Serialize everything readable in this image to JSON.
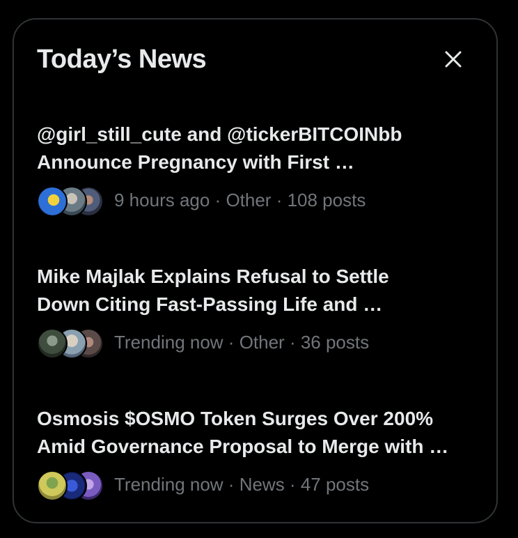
{
  "panel": {
    "title": "Today’s News",
    "close_label": "Close"
  },
  "news": [
    {
      "headline": "@girl_still_cute and @tickerBITCOINbb\nAnnounce Pregnancy with First …",
      "time": "9 hours ago",
      "category": "Other",
      "posts": "108 posts"
    },
    {
      "headline": "Mike Majlak Explains Refusal to Settle\nDown Citing Fast-Passing Life and …",
      "time": "Trending now",
      "category": "Other",
      "posts": "36 posts"
    },
    {
      "headline": "Osmosis $OSMO Token Surges Over 200%\nAmid Governance Proposal to Merge with …",
      "time": "Trending now",
      "category": "News",
      "posts": "47 posts"
    }
  ],
  "separator": " · ",
  "colors": {
    "background": "#000000",
    "border": "#2f3336",
    "text": "#e7e9ea",
    "muted": "#71767b"
  }
}
